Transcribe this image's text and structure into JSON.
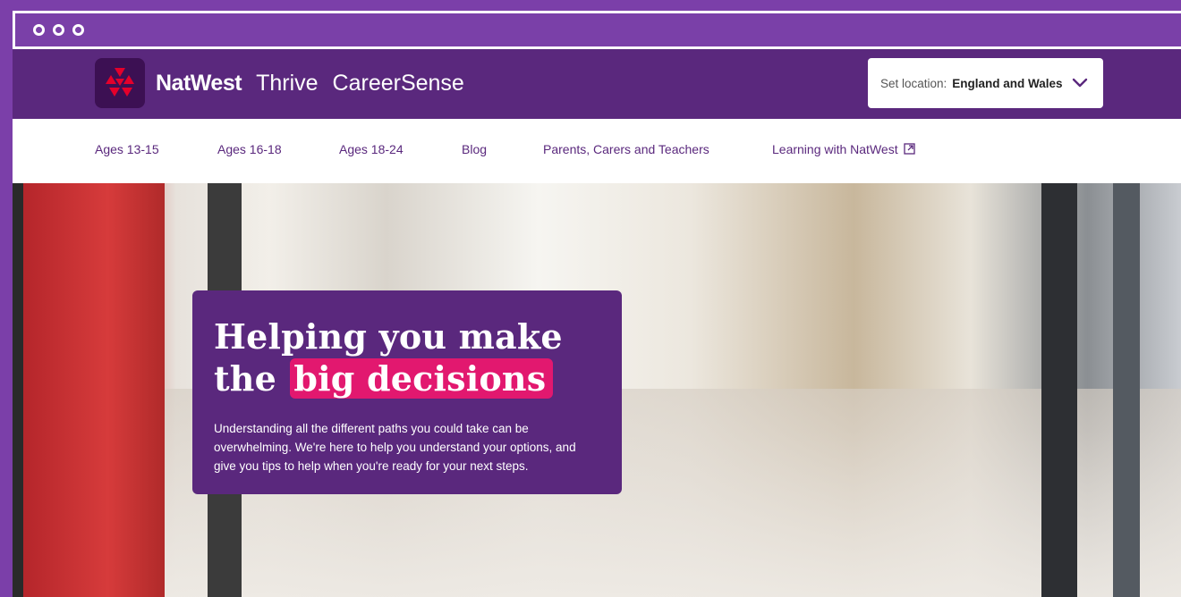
{
  "browser": {
    "window_controls": [
      "dot",
      "dot",
      "dot"
    ]
  },
  "header": {
    "brand_name": "NatWest",
    "brand_sub1": "Thrive",
    "brand_sub2": "CareerSense",
    "location_label": "Set location:",
    "location_value": "England and Wales"
  },
  "nav": {
    "items": [
      {
        "label": "Ages 13-15"
      },
      {
        "label": "Ages 16-18"
      },
      {
        "label": "Ages 18-24"
      },
      {
        "label": "Blog"
      },
      {
        "label": "Parents, Carers and Teachers"
      },
      {
        "label": "Learning with NatWest"
      }
    ]
  },
  "hero": {
    "headline_line1": "Helping you make",
    "headline_the": "the",
    "headline_highlight": "big decisions",
    "blurb": "Understanding all the different paths you could take can be overwhelming. We're here to help you understand your options, and give you tips to help when you're ready for your next steps."
  },
  "colors": {
    "brand_purple": "#5a287d",
    "chrome_purple": "#7b3fa9",
    "highlight_pink": "#e2186f",
    "logo_red": "#e4002b"
  },
  "icons": {
    "logo": "natwest-logo-icon",
    "location_chevron": "chevron-down-icon",
    "external_link": "external-link-icon"
  }
}
